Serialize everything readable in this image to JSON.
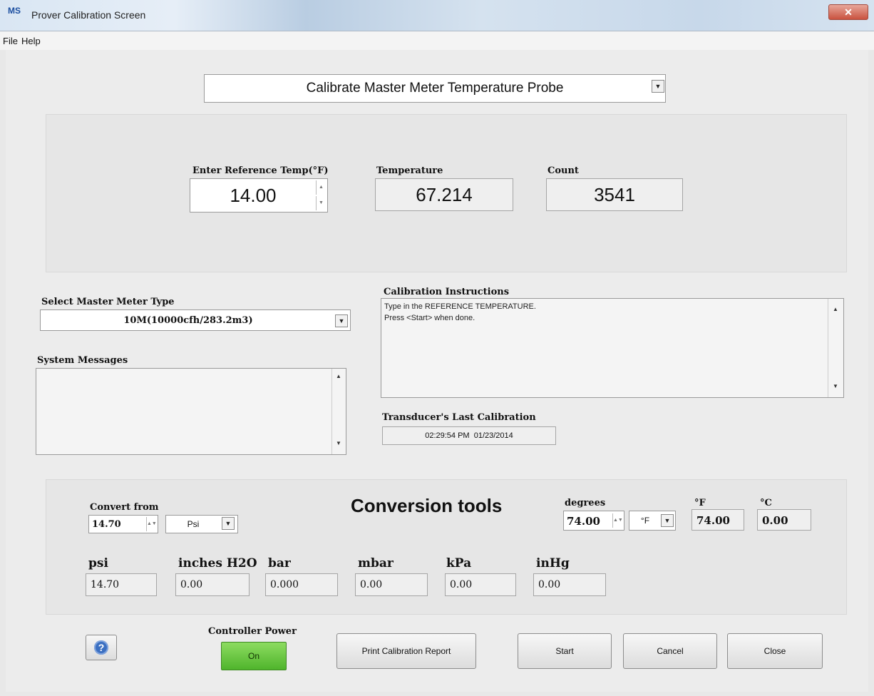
{
  "window": {
    "title": "Prover Calibration Screen",
    "icon_text": "MS",
    "close_glyph": "✕"
  },
  "menu": {
    "items": [
      "File",
      "Help"
    ]
  },
  "mode_select": {
    "value": "Calibrate Master Meter Temperature Probe"
  },
  "probe": {
    "ref_temp_label": "Enter Reference Temp(°F)",
    "ref_temp_value": "14.00",
    "temperature_label": "Temperature",
    "temperature_value": "67.214",
    "count_label": "Count",
    "count_value": "3541"
  },
  "master_meter": {
    "label": "Select Master Meter Type",
    "value": "10M(10000cfh/283.2m3)"
  },
  "system_messages": {
    "label": "System Messages"
  },
  "instructions": {
    "label": "Calibration Instructions",
    "lines": [
      "Type in the REFERENCE TEMPERATURE.",
      "Press <Start> when done."
    ]
  },
  "last_calibration": {
    "label": "Transducer's Last Calibration",
    "value": "02:29:54 PM  01/23/2014"
  },
  "conversion": {
    "title": "Conversion tools",
    "convert_from_label": "Convert from",
    "convert_from_value": "14.70",
    "convert_from_unit": "Psi",
    "degrees_label": "degrees",
    "degrees_value": "74.00",
    "degrees_unit": "°F",
    "f_label": "°F",
    "f_value": "74.00",
    "c_label": "°C",
    "c_value": "0.00",
    "units": [
      {
        "label": "psi",
        "value": "14.70"
      },
      {
        "label": "inches H2O",
        "value": "0.00"
      },
      {
        "label": "bar",
        "value": "0.000"
      },
      {
        "label": "mbar",
        "value": "0.00"
      },
      {
        "label": "kPa",
        "value": "0.00"
      },
      {
        "label": "inHg",
        "value": "0.00"
      }
    ]
  },
  "footer": {
    "help_icon": "?",
    "controller_power_label": "Controller Power",
    "controller_power_value": "On",
    "print_report": "Print Calibration Report",
    "start": "Start",
    "cancel": "Cancel",
    "close": "Close"
  },
  "colors": {
    "power_on": "#5fc23a",
    "help_blue": "#3b6fc1",
    "title_gradient": "#d9e6f3"
  }
}
